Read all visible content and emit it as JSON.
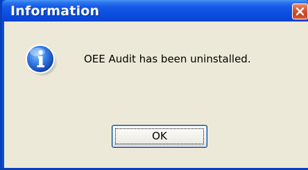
{
  "dialog": {
    "title": "Information",
    "message": "OEE Audit has been uninstalled.",
    "ok_label": "OK",
    "icons": {
      "close": "close-icon",
      "info": "info-icon"
    },
    "colors": {
      "titlebar": "#0a48d6",
      "close_button": "#c9421f",
      "client_background": "#ece9d8",
      "info_icon_blue": "#1b5fd1"
    }
  }
}
